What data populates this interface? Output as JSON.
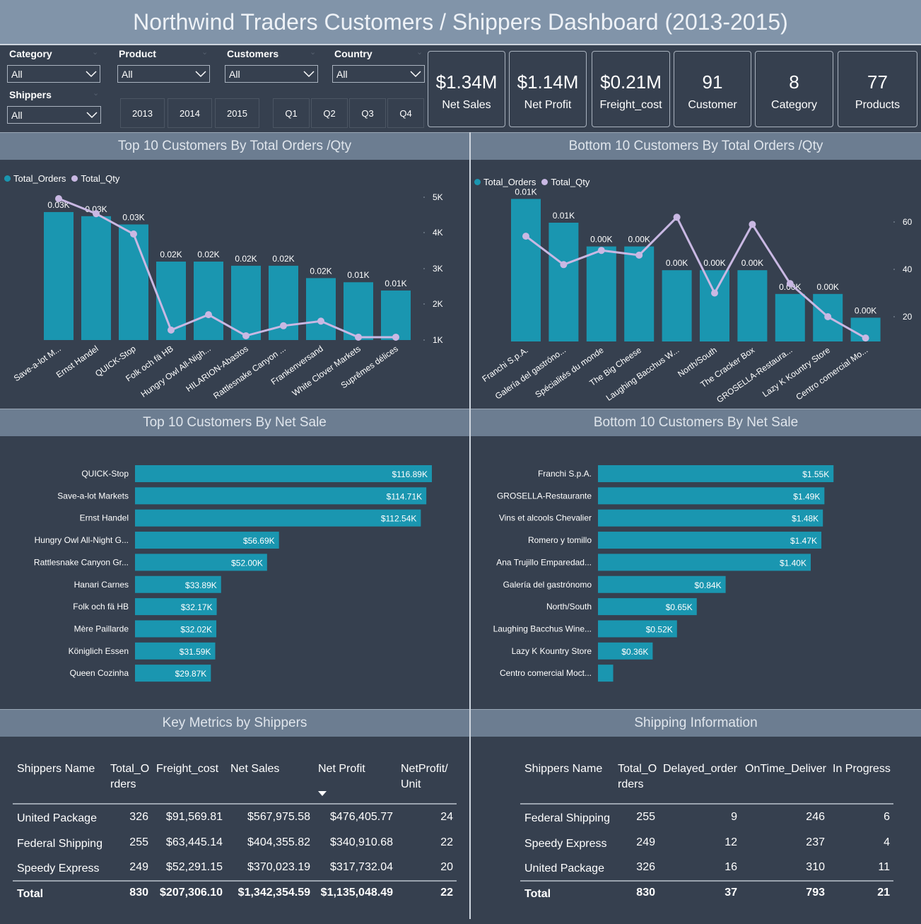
{
  "title": "Northwind Traders Customers / Shippers Dashboard (2013-2015)",
  "colors": {
    "bar": "#1a96b0",
    "line": "#c9b8e3",
    "background": "#36404f",
    "header": "#6c7d91"
  },
  "filters": {
    "dropdowns": [
      {
        "label": "Category",
        "value": "All"
      },
      {
        "label": "Product",
        "value": "All"
      },
      {
        "label": "Customers",
        "value": "All"
      },
      {
        "label": "Country",
        "value": "All"
      },
      {
        "label": "Shippers",
        "value": "All"
      }
    ],
    "years": [
      "2013",
      "2014",
      "2015"
    ],
    "quarters": [
      "Q1",
      "Q2",
      "Q3",
      "Q4"
    ]
  },
  "kpis": [
    {
      "value": "$1.34M",
      "label": "Net Sales"
    },
    {
      "value": "$1.14M",
      "label": "Net Profit"
    },
    {
      "value": "$0.21M",
      "label": "Freight_cost"
    },
    {
      "value": "91",
      "label": "Customer"
    },
    {
      "value": "8",
      "label": "Category"
    },
    {
      "value": "77",
      "label": "Products"
    }
  ],
  "sections": {
    "top_orders": "Top 10 Customers By Total Orders /Qty",
    "bottom_orders": "Bottom 10 Customers By Total Orders /Qty",
    "top_sales": "Top 10 Customers By Net Sale",
    "bottom_sales": "Bottom 10 Customers By Net Sale",
    "shippers_metrics": "Key Metrics by Shippers",
    "shipping_info": "Shipping Information"
  },
  "chart_data": [
    {
      "type": "bar+line",
      "title": "Top 10 Customers By Total Orders /Qty",
      "legend": [
        "Total_Orders",
        "Total_Qty"
      ],
      "legend_position": "top-left",
      "categories": [
        "Save-a-lot M...",
        "Ernst Handel",
        "QUICK-Stop",
        "Folk och fä HB",
        "Hungry Owl All-Nigh...",
        "HILARION-Abastos",
        "Rattlesnake Canyon ...",
        "Frankenversand",
        "White Clover Markets",
        "Suprêmes délices"
      ],
      "series": [
        {
          "name": "Total_Orders",
          "type": "bar",
          "values": [
            31,
            30,
            28,
            19,
            19,
            18,
            18,
            15,
            14,
            12
          ],
          "data_labels": [
            "0.03K",
            "0.03K",
            "0.03K",
            "0.02K",
            "0.02K",
            "0.02K",
            "0.02K",
            "0.02K",
            "0.01K",
            "0.01K"
          ]
        },
        {
          "name": "Total_Qty",
          "type": "line",
          "values": [
            4960,
            4540,
            3970,
            1280,
            1710,
            1120,
            1400,
            1530,
            1080,
            1080
          ]
        }
      ],
      "y2_ticks": [
        "1K",
        "2K",
        "3K",
        "4K",
        "5K"
      ],
      "y2lim": [
        1000,
        5200
      ],
      "grid": false
    },
    {
      "type": "bar+line",
      "title": "Bottom 10 Customers By Total Orders /Qty",
      "legend": [
        "Total_Orders",
        "Total_Qty"
      ],
      "legend_position": "top-left",
      "categories": [
        "Franchi S.p.A.",
        "Galería del gastróno...",
        "Spécialités du monde",
        "The Big Cheese",
        "Laughing Bacchus W...",
        "North/South",
        "The Cracker Box",
        "GROSELLA-Restaura...",
        "Lazy K Kountry Store",
        "Centro comercial Mo..."
      ],
      "series": [
        {
          "name": "Total_Orders",
          "type": "bar",
          "values": [
            6,
            5,
            4,
            4,
            3,
            3,
            3,
            2,
            2,
            1
          ],
          "data_labels": [
            "0.01K",
            "0.01K",
            "0.00K",
            "0.00K",
            "0.00K",
            "0.00K",
            "0.00K",
            "0.00K",
            "0.00K",
            "0.00K"
          ]
        },
        {
          "name": "Total_Qty",
          "type": "line",
          "values": [
            54,
            42,
            48,
            46,
            62,
            30,
            59,
            34,
            20,
            11
          ]
        }
      ],
      "y2_ticks": [
        "20",
        "40",
        "60"
      ],
      "y2lim": [
        10,
        70
      ],
      "grid": false
    },
    {
      "type": "bar",
      "orientation": "horizontal",
      "title": "Top 10 Customers By Net Sale",
      "categories": [
        "QUICK-Stop",
        "Save-a-lot Markets",
        "Ernst Handel",
        "Hungry Owl All-Night G...",
        "Rattlesnake Canyon Gr...",
        "Hanari Carnes",
        "Folk och fä HB",
        "Mère Paillarde",
        "Königlich Essen",
        "Queen Cozinha"
      ],
      "values": [
        116.89,
        114.71,
        112.54,
        56.69,
        52.0,
        33.89,
        32.17,
        32.02,
        31.59,
        29.87
      ],
      "data_labels": [
        "$116.89K",
        "$114.71K",
        "$112.54K",
        "$56.69K",
        "$52.00K",
        "$33.89K",
        "$32.17K",
        "$32.02K",
        "$31.59K",
        "$29.87K"
      ],
      "unit": "$K"
    },
    {
      "type": "bar",
      "orientation": "horizontal",
      "title": "Bottom 10 Customers By Net Sale",
      "categories": [
        "Franchi S.p.A.",
        "GROSELLA-Restaurante",
        "Vins et alcools Chevalier",
        "Romero y tomillo",
        "Ana Trujillo Emparedad...",
        "Galería del gastrónomo",
        "North/South",
        "Laughing Bacchus Wine...",
        "Lazy K Kountry Store",
        "Centro comercial Moct..."
      ],
      "values": [
        1.55,
        1.49,
        1.48,
        1.47,
        1.4,
        0.84,
        0.65,
        0.52,
        0.36,
        0.1
      ],
      "data_labels": [
        "$1.55K",
        "$1.49K",
        "$1.48K",
        "$1.47K",
        "$1.40K",
        "$0.84K",
        "$0.65K",
        "$0.52K",
        "$0.36K",
        ""
      ],
      "unit": "$K"
    }
  ],
  "shippers_table": {
    "headers": [
      "Shippers Name",
      "Total_O rders",
      "Freight_cost",
      "Net Sales",
      "Net Profit",
      "NetProfit/ Unit"
    ],
    "sorted_column": "Net Profit",
    "rows": [
      [
        "United Package",
        "326",
        "$91,569.81",
        "$567,975.58",
        "$476,405.77",
        "24"
      ],
      [
        "Federal Shipping",
        "255",
        "$63,445.14",
        "$404,355.82",
        "$340,910.68",
        "22"
      ],
      [
        "Speedy Express",
        "249",
        "$52,291.15",
        "$370,023.19",
        "$317,732.04",
        "20"
      ]
    ],
    "total": [
      "Total",
      "830",
      "$207,306.10",
      "$1,342,354.59",
      "$1,135,048.49",
      "22"
    ]
  },
  "shipping_table": {
    "headers": [
      "Shippers Name",
      "Total_O rders",
      "Delayed_order",
      "OnTime_Deliver",
      "In Progress"
    ],
    "rows": [
      [
        "Federal Shipping",
        "255",
        "9",
        "246",
        "6"
      ],
      [
        "Speedy Express",
        "249",
        "12",
        "237",
        "4"
      ],
      [
        "United Package",
        "326",
        "16",
        "310",
        "11"
      ]
    ],
    "total": [
      "Total",
      "830",
      "37",
      "793",
      "21"
    ]
  }
}
